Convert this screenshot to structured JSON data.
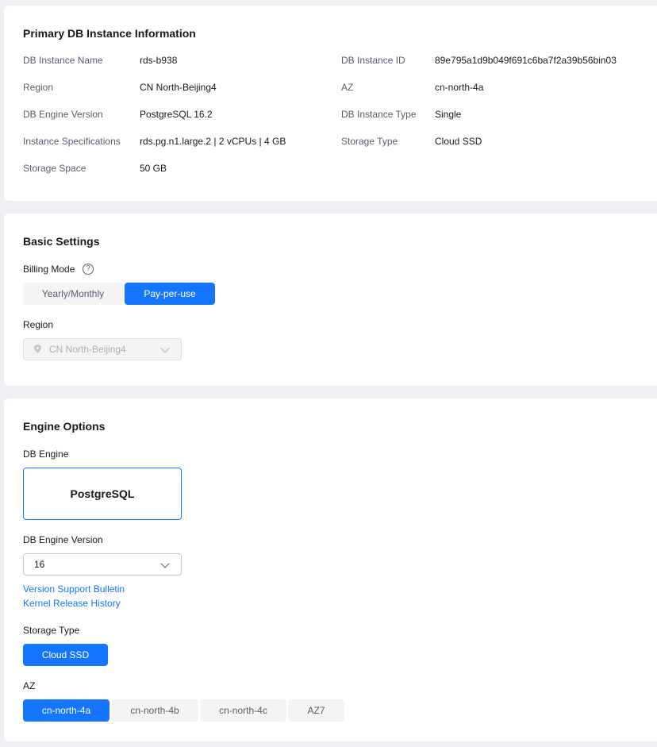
{
  "primary": {
    "title": "Primary DB Instance Information",
    "left": [
      {
        "label": "DB Instance Name",
        "value": "rds-b938"
      },
      {
        "label": "Region",
        "value": "CN North-Beijing4"
      },
      {
        "label": "DB Engine Version",
        "value": "PostgreSQL 16.2"
      },
      {
        "label": "Instance Specifications",
        "value": "rds.pg.n1.large.2 | 2 vCPUs | 4 GB"
      },
      {
        "label": "Storage Space",
        "value": "50 GB"
      }
    ],
    "right": [
      {
        "label": "DB Instance ID",
        "value": "89e795a1d9b049f691c6ba7f2a39b56bin03"
      },
      {
        "label": "AZ",
        "value": "cn-north-4a"
      },
      {
        "label": "DB Instance Type",
        "value": "Single"
      },
      {
        "label": "Storage Type",
        "value": "Cloud SSD"
      }
    ]
  },
  "basic": {
    "title": "Basic Settings",
    "billing_label": "Billing Mode",
    "help_glyph": "?",
    "billing_options": [
      "Yearly/Monthly",
      "Pay-per-use"
    ],
    "billing_selected": "Pay-per-use",
    "region_label": "Region",
    "region_value": "CN North-Beijing4"
  },
  "engine": {
    "title": "Engine Options",
    "db_engine_label": "DB Engine",
    "db_engine_value": "PostgreSQL",
    "version_label": "DB Engine Version",
    "version_value": "16",
    "links": [
      "Version Support Bulletin",
      "Kernel Release History"
    ],
    "storage_label": "Storage Type",
    "storage_value": "Cloud SSD",
    "az_label": "AZ",
    "az_options": [
      "cn-north-4a",
      "cn-north-4b",
      "cn-north-4c",
      "AZ7"
    ],
    "az_selected": "cn-north-4a"
  },
  "colors": {
    "accent": "#1476ff",
    "background": "#eff0f3",
    "muted": "#575d6c"
  }
}
